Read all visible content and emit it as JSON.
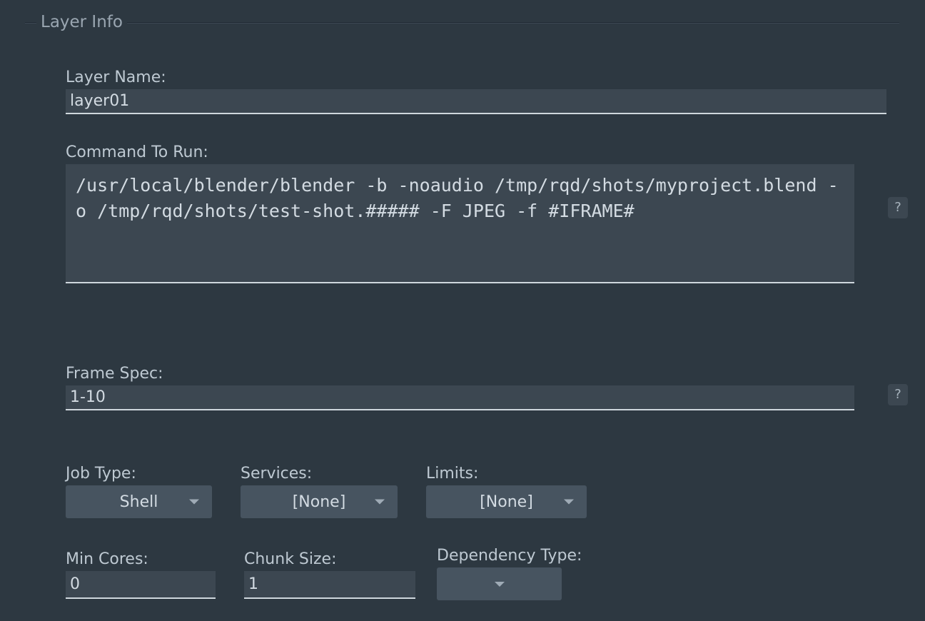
{
  "group": {
    "title": "Layer Info"
  },
  "layer_name": {
    "label": "Layer Name:",
    "value": "layer01"
  },
  "command": {
    "label": "Command To Run:",
    "value": "/usr/local/blender/blender -b -noaudio /tmp/rqd/shots/myproject.blend -o /tmp/rqd/shots/test-shot.##### -F JPEG -f #IFRAME#",
    "help": "?"
  },
  "frame_spec": {
    "label": "Frame Spec:",
    "value": "1-10",
    "help": "?"
  },
  "job_type": {
    "label": "Job Type:",
    "selected": "Shell"
  },
  "services": {
    "label": "Services:",
    "selected": "[None]"
  },
  "limits": {
    "label": "Limits:",
    "selected": "[None]"
  },
  "min_cores": {
    "label": "Min Cores:",
    "value": "0"
  },
  "chunk_size": {
    "label": "Chunk Size:",
    "value": "1"
  },
  "dependency_type": {
    "label": "Dependency Type:",
    "selected": ""
  }
}
